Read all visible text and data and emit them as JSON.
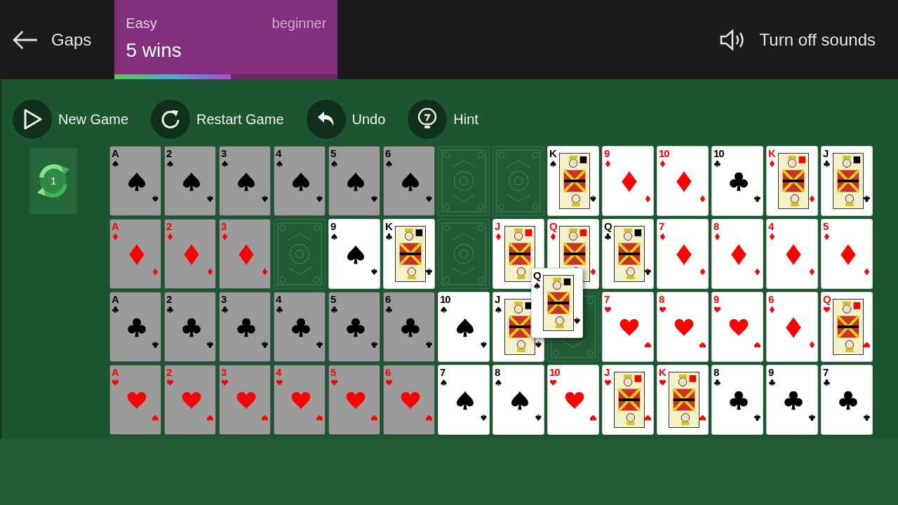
{
  "header": {
    "back_label": "Gaps",
    "stats": {
      "difficulty": "Easy",
      "rank": "beginner",
      "wins": "5 wins",
      "level": 0.52
    },
    "sound_label": "Turn off sounds"
  },
  "toolbar": [
    {
      "kind": "new",
      "label": "New Game"
    },
    {
      "kind": "restart",
      "label": "Restart Game"
    },
    {
      "kind": "undo",
      "label": "Undo"
    },
    {
      "kind": "hint",
      "label": "Hint"
    }
  ],
  "redeal": {
    "count": "1"
  },
  "rows": [
    [
      {
        "kind": "pip",
        "rank": "A",
        "suit": {
          "kind": "spades"
        },
        "dimmed": true
      },
      {
        "kind": "pip",
        "rank": "2",
        "suit": {
          "kind": "spades"
        },
        "dimmed": true
      },
      {
        "kind": "pip",
        "rank": "3",
        "suit": {
          "kind": "spades"
        },
        "dimmed": true
      },
      {
        "kind": "pip",
        "rank": "4",
        "suit": {
          "kind": "spades"
        },
        "dimmed": true
      },
      {
        "kind": "pip",
        "rank": "5",
        "suit": {
          "kind": "spades"
        },
        "dimmed": true
      },
      {
        "kind": "pip",
        "rank": "6",
        "suit": {
          "kind": "spades"
        },
        "dimmed": true
      },
      {
        "kind": "gap"
      },
      {
        "kind": "gap"
      },
      {
        "kind": "face",
        "rank": "K",
        "suit": {
          "kind": "spades"
        },
        "dimmed": false
      },
      {
        "kind": "pip",
        "rank": "9",
        "suit": {
          "kind": "diamonds"
        },
        "dimmed": false
      },
      {
        "kind": "pip",
        "rank": "10",
        "suit": {
          "kind": "diamonds"
        },
        "dimmed": false
      },
      {
        "kind": "pip",
        "rank": "10",
        "suit": {
          "kind": "clubs"
        },
        "dimmed": false
      },
      {
        "kind": "face",
        "rank": "K",
        "suit": {
          "kind": "diamonds"
        },
        "dimmed": false
      },
      {
        "kind": "face",
        "rank": "J",
        "suit": {
          "kind": "clubs"
        },
        "dimmed": false
      }
    ],
    [
      {
        "kind": "pip",
        "rank": "A",
        "suit": {
          "kind": "diamonds"
        },
        "dimmed": true
      },
      {
        "kind": "pip",
        "rank": "2",
        "suit": {
          "kind": "diamonds"
        },
        "dimmed": true
      },
      {
        "kind": "pip",
        "rank": "3",
        "suit": {
          "kind": "diamonds"
        },
        "dimmed": true
      },
      {
        "kind": "gap"
      },
      {
        "kind": "pip",
        "rank": "9",
        "suit": {
          "kind": "spades"
        },
        "dimmed": false
      },
      {
        "kind": "face",
        "rank": "K",
        "suit": {
          "kind": "clubs"
        },
        "dimmed": false
      },
      {
        "kind": "gap"
      },
      {
        "kind": "face",
        "rank": "J",
        "suit": {
          "kind": "diamonds"
        },
        "dimmed": false
      },
      {
        "kind": "face",
        "rank": "Q",
        "suit": {
          "kind": "diamonds"
        },
        "dimmed": false
      },
      {
        "kind": "face",
        "rank": "Q",
        "suit": {
          "kind": "clubs"
        },
        "dimmed": false
      },
      {
        "kind": "pip",
        "rank": "7",
        "suit": {
          "kind": "diamonds"
        },
        "dimmed": false
      },
      {
        "kind": "pip",
        "rank": "8",
        "suit": {
          "kind": "diamonds"
        },
        "dimmed": false
      },
      {
        "kind": "pip",
        "rank": "4",
        "suit": {
          "kind": "diamonds"
        },
        "dimmed": false
      },
      {
        "kind": "pip",
        "rank": "5",
        "suit": {
          "kind": "diamonds"
        },
        "dimmed": false
      }
    ],
    [
      {
        "kind": "pip",
        "rank": "A",
        "suit": {
          "kind": "clubs"
        },
        "dimmed": true
      },
      {
        "kind": "pip",
        "rank": "2",
        "suit": {
          "kind": "clubs"
        },
        "dimmed": true
      },
      {
        "kind": "pip",
        "rank": "3",
        "suit": {
          "kind": "clubs"
        },
        "dimmed": true
      },
      {
        "kind": "pip",
        "rank": "4",
        "suit": {
          "kind": "clubs"
        },
        "dimmed": true
      },
      {
        "kind": "pip",
        "rank": "5",
        "suit": {
          "kind": "clubs"
        },
        "dimmed": true
      },
      {
        "kind": "pip",
        "rank": "6",
        "suit": {
          "kind": "clubs"
        },
        "dimmed": true
      },
      {
        "kind": "pip",
        "rank": "10",
        "suit": {
          "kind": "spades"
        },
        "dimmed": false
      },
      {
        "kind": "face",
        "rank": "J",
        "suit": {
          "kind": "spades"
        },
        "dimmed": false
      },
      {
        "kind": "gap"
      },
      {
        "kind": "pip",
        "rank": "7",
        "suit": {
          "kind": "hearts"
        },
        "dimmed": false
      },
      {
        "kind": "pip",
        "rank": "8",
        "suit": {
          "kind": "hearts"
        },
        "dimmed": false
      },
      {
        "kind": "pip",
        "rank": "9",
        "suit": {
          "kind": "hearts"
        },
        "dimmed": false
      },
      {
        "kind": "pip",
        "rank": "6",
        "suit": {
          "kind": "diamonds"
        },
        "dimmed": false
      },
      {
        "kind": "face",
        "rank": "Q",
        "suit": {
          "kind": "hearts"
        },
        "dimmed": false
      }
    ],
    [
      {
        "kind": "pip",
        "rank": "A",
        "suit": {
          "kind": "hearts"
        },
        "dimmed": true
      },
      {
        "kind": "pip",
        "rank": "2",
        "suit": {
          "kind": "hearts"
        },
        "dimmed": true
      },
      {
        "kind": "pip",
        "rank": "3",
        "suit": {
          "kind": "hearts"
        },
        "dimmed": true
      },
      {
        "kind": "pip",
        "rank": "4",
        "suit": {
          "kind": "hearts"
        },
        "dimmed": true
      },
      {
        "kind": "pip",
        "rank": "5",
        "suit": {
          "kind": "hearts"
        },
        "dimmed": true
      },
      {
        "kind": "pip",
        "rank": "6",
        "suit": {
          "kind": "hearts"
        },
        "dimmed": true
      },
      {
        "kind": "pip",
        "rank": "7",
        "suit": {
          "kind": "spades"
        },
        "dimmed": false
      },
      {
        "kind": "pip",
        "rank": "8",
        "suit": {
          "kind": "spades"
        },
        "dimmed": false
      },
      {
        "kind": "pip",
        "rank": "10",
        "suit": {
          "kind": "hearts"
        },
        "dimmed": false
      },
      {
        "kind": "face",
        "rank": "J",
        "suit": {
          "kind": "hearts"
        },
        "dimmed": false
      },
      {
        "kind": "face",
        "rank": "K",
        "suit": {
          "kind": "hearts"
        },
        "dimmed": false
      },
      {
        "kind": "pip",
        "rank": "8",
        "suit": {
          "kind": "clubs"
        },
        "dimmed": false
      },
      {
        "kind": "pip",
        "rank": "9",
        "suit": {
          "kind": "clubs"
        },
        "dimmed": false
      },
      {
        "kind": "pip",
        "rank": "7",
        "suit": {
          "kind": "clubs"
        },
        "dimmed": false
      }
    ]
  ],
  "dragged_card": {
    "kind": "face",
    "rank": "Q",
    "suit": {
      "kind": "spades"
    },
    "dimmed": false
  }
}
